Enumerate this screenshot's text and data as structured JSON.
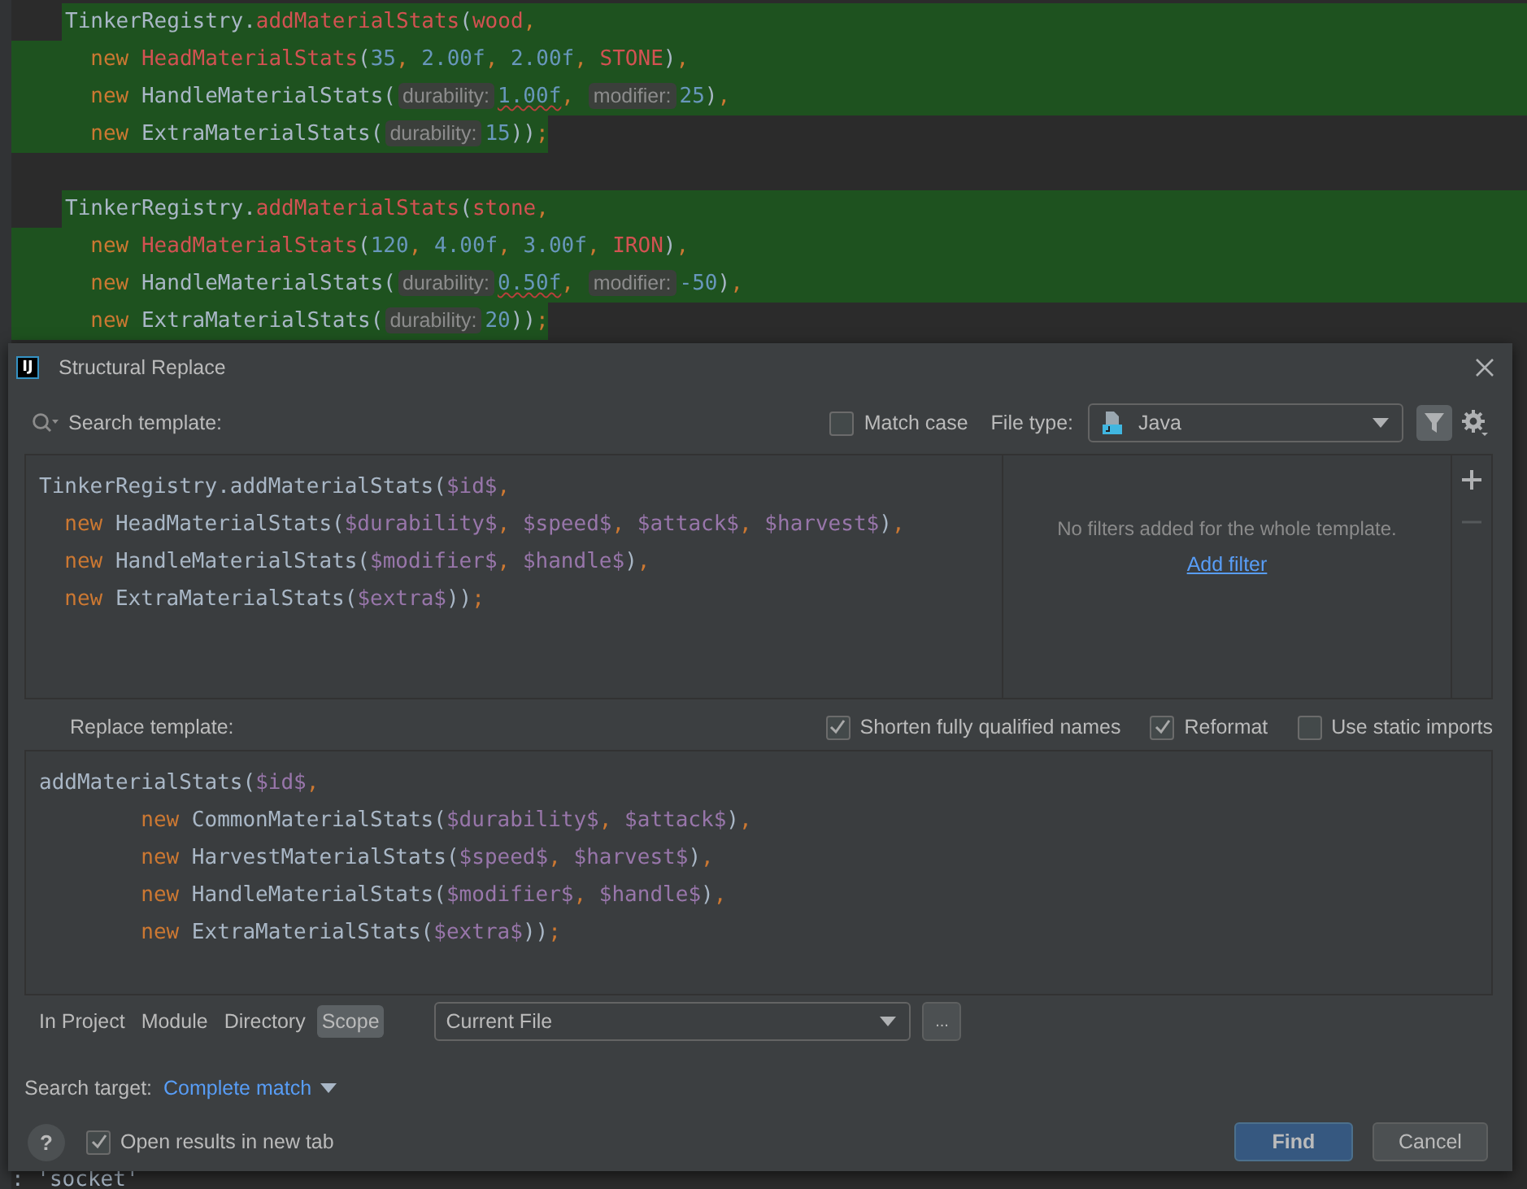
{
  "editor": {
    "lines": [
      {
        "kind": "start",
        "tokens": [
          {
            "t": "TinkerRegistry.",
            "kind": "plain"
          },
          {
            "t": "addMaterialStats",
            "kind": "error"
          },
          {
            "t": "(",
            "kind": "plain"
          },
          {
            "t": "wood",
            "kind": "error"
          },
          {
            "t": ",",
            "kind": "punct"
          }
        ]
      },
      {
        "kind": "middle",
        "tokens": [
          {
            "t": "  new ",
            "kind": "keyword"
          },
          {
            "t": "HeadMaterialStats",
            "kind": "error"
          },
          {
            "t": "(",
            "kind": "plain"
          },
          {
            "t": "35",
            "kind": "number"
          },
          {
            "t": ", ",
            "kind": "punct"
          },
          {
            "t": "2.00f",
            "kind": "number"
          },
          {
            "t": ", ",
            "kind": "punct"
          },
          {
            "t": "2.00f",
            "kind": "number"
          },
          {
            "t": ", ",
            "kind": "punct"
          },
          {
            "t": "STONE",
            "kind": "error"
          },
          {
            "t": ")",
            "kind": "plain"
          },
          {
            "t": ",",
            "kind": "punct"
          }
        ]
      },
      {
        "kind": "middle",
        "tokens": [
          {
            "t": "  new ",
            "kind": "keyword"
          },
          {
            "t": "HandleMaterialStats(",
            "kind": "plain"
          },
          {
            "t": "durability:",
            "kind": "hint"
          },
          {
            "t": "1.00f",
            "kind": "warn"
          },
          {
            "t": ", ",
            "kind": "punct"
          },
          {
            "t": "modifier:",
            "kind": "hint"
          },
          {
            "t": "25",
            "kind": "number"
          },
          {
            "t": ")",
            "kind": "plain"
          },
          {
            "t": ",",
            "kind": "punct"
          }
        ]
      },
      {
        "kind": "end",
        "tokens": [
          {
            "t": "  new ",
            "kind": "keyword"
          },
          {
            "t": "ExtraMaterialStats(",
            "kind": "plain"
          },
          {
            "t": "durability:",
            "kind": "hint"
          },
          {
            "t": "15",
            "kind": "number"
          },
          {
            "t": "))",
            "kind": "plain"
          },
          {
            "t": ";",
            "kind": "punct"
          }
        ]
      },
      {
        "kind": "blank"
      },
      {
        "kind": "start",
        "tokens": [
          {
            "t": "TinkerRegistry.",
            "kind": "plain"
          },
          {
            "t": "addMaterialStats",
            "kind": "error"
          },
          {
            "t": "(",
            "kind": "plain"
          },
          {
            "t": "stone",
            "kind": "error"
          },
          {
            "t": ",",
            "kind": "punct"
          }
        ]
      },
      {
        "kind": "middle",
        "tokens": [
          {
            "t": "  new ",
            "kind": "keyword"
          },
          {
            "t": "HeadMaterialStats",
            "kind": "error"
          },
          {
            "t": "(",
            "kind": "plain"
          },
          {
            "t": "120",
            "kind": "number"
          },
          {
            "t": ", ",
            "kind": "punct"
          },
          {
            "t": "4.00f",
            "kind": "number"
          },
          {
            "t": ", ",
            "kind": "punct"
          },
          {
            "t": "3.00f",
            "kind": "number"
          },
          {
            "t": ", ",
            "kind": "punct"
          },
          {
            "t": "IRON",
            "kind": "error"
          },
          {
            "t": ")",
            "kind": "plain"
          },
          {
            "t": ",",
            "kind": "punct"
          }
        ]
      },
      {
        "kind": "middle",
        "tokens": [
          {
            "t": "  new ",
            "kind": "keyword"
          },
          {
            "t": "HandleMaterialStats(",
            "kind": "plain"
          },
          {
            "t": "durability:",
            "kind": "hint"
          },
          {
            "t": "0.50f",
            "kind": "warn"
          },
          {
            "t": ", ",
            "kind": "punct"
          },
          {
            "t": "modifier:",
            "kind": "hint"
          },
          {
            "t": "-50",
            "kind": "number"
          },
          {
            "t": ")",
            "kind": "plain"
          },
          {
            "t": ",",
            "kind": "punct"
          }
        ]
      },
      {
        "kind": "end",
        "tokens": [
          {
            "t": "  new ",
            "kind": "keyword"
          },
          {
            "t": "ExtraMaterialStats(",
            "kind": "plain"
          },
          {
            "t": "durability:",
            "kind": "hint"
          },
          {
            "t": "20",
            "kind": "number"
          },
          {
            "t": "))",
            "kind": "plain"
          },
          {
            "t": ";",
            "kind": "punct"
          }
        ]
      }
    ],
    "bottom_line": [
      {
        "t": ": ",
        "kind": "plain"
      },
      {
        "t": "'socket'",
        "kind": "plain"
      }
    ]
  },
  "dialog": {
    "app_icon": "IJ",
    "title": "Structural Replace",
    "search_label": "Search template:",
    "match_case": {
      "label": "Match case",
      "checked": false
    },
    "file_type": {
      "label": "File type:",
      "value": "Java"
    },
    "filter_button": {
      "selected": true
    },
    "search_template": [
      [
        {
          "t": "TinkerRegistry.addMaterialStats(",
          "kind": "plain"
        },
        {
          "t": "$id$",
          "kind": "var"
        },
        {
          "t": ",",
          "kind": "punct"
        }
      ],
      [
        {
          "t": "  new ",
          "kind": "keyword"
        },
        {
          "t": "HeadMaterialStats(",
          "kind": "plain"
        },
        {
          "t": "$durability$",
          "kind": "var"
        },
        {
          "t": ", ",
          "kind": "punct"
        },
        {
          "t": "$speed$",
          "kind": "var"
        },
        {
          "t": ", ",
          "kind": "punct"
        },
        {
          "t": "$attack$",
          "kind": "var"
        },
        {
          "t": ", ",
          "kind": "punct"
        },
        {
          "t": "$harvest$",
          "kind": "var"
        },
        {
          "t": ")",
          "kind": "plain"
        },
        {
          "t": ",",
          "kind": "punct"
        }
      ],
      [
        {
          "t": "  new ",
          "kind": "keyword"
        },
        {
          "t": "HandleMaterialStats(",
          "kind": "plain"
        },
        {
          "t": "$modifier$",
          "kind": "var"
        },
        {
          "t": ", ",
          "kind": "punct"
        },
        {
          "t": "$handle$",
          "kind": "var"
        },
        {
          "t": ")",
          "kind": "plain"
        },
        {
          "t": ",",
          "kind": "punct"
        }
      ],
      [
        {
          "t": "  new ",
          "kind": "keyword"
        },
        {
          "t": "ExtraMaterialStats(",
          "kind": "plain"
        },
        {
          "t": "$extra$",
          "kind": "var"
        },
        {
          "t": "))",
          "kind": "plain"
        },
        {
          "t": ";",
          "kind": "punct"
        }
      ]
    ],
    "filters": {
      "empty_text": "No filters added for the whole template.",
      "link": "Add filter"
    },
    "replace_label": "Replace template:",
    "options": [
      {
        "label": "Shorten fully qualified names",
        "checked": true
      },
      {
        "label": "Reformat",
        "checked": true
      },
      {
        "label": "Use static imports",
        "checked": false
      }
    ],
    "replace_template": [
      [
        {
          "t": "addMaterialStats(",
          "kind": "plain"
        },
        {
          "t": "$id$",
          "kind": "var"
        },
        {
          "t": ",",
          "kind": "punct"
        }
      ],
      [
        {
          "t": "        new ",
          "kind": "keyword"
        },
        {
          "t": "CommonMaterialStats(",
          "kind": "plain"
        },
        {
          "t": "$durability$",
          "kind": "var"
        },
        {
          "t": ", ",
          "kind": "punct"
        },
        {
          "t": "$attack$",
          "kind": "var"
        },
        {
          "t": ")",
          "kind": "plain"
        },
        {
          "t": ",",
          "kind": "punct"
        }
      ],
      [
        {
          "t": "        new ",
          "kind": "keyword"
        },
        {
          "t": "HarvestMaterialStats(",
          "kind": "plain"
        },
        {
          "t": "$speed$",
          "kind": "var"
        },
        {
          "t": ", ",
          "kind": "punct"
        },
        {
          "t": "$harvest$",
          "kind": "var"
        },
        {
          "t": ")",
          "kind": "plain"
        },
        {
          "t": ",",
          "kind": "punct"
        }
      ],
      [
        {
          "t": "        new ",
          "kind": "keyword"
        },
        {
          "t": "HandleMaterialStats(",
          "kind": "plain"
        },
        {
          "t": "$modifier$",
          "kind": "var"
        },
        {
          "t": ", ",
          "kind": "punct"
        },
        {
          "t": "$handle$",
          "kind": "var"
        },
        {
          "t": ")",
          "kind": "plain"
        },
        {
          "t": ",",
          "kind": "punct"
        }
      ],
      [
        {
          "t": "        new ",
          "kind": "keyword"
        },
        {
          "t": "ExtraMaterialStats(",
          "kind": "plain"
        },
        {
          "t": "$extra$",
          "kind": "var"
        },
        {
          "t": "))",
          "kind": "plain"
        },
        {
          "t": ";",
          "kind": "punct"
        }
      ]
    ],
    "scope_tabs": [
      {
        "label": "In Project",
        "selected": false
      },
      {
        "label": "Module",
        "selected": false
      },
      {
        "label": "Directory",
        "selected": false
      },
      {
        "label": "Scope",
        "selected": true
      }
    ],
    "scope_value": "Current File",
    "browse_button": "...",
    "search_target": {
      "label": "Search target:",
      "value": "Complete match"
    },
    "help": "?",
    "open_in_new_tab": {
      "label": "Open results in new tab",
      "checked": true
    },
    "buttons": [
      {
        "label": "Find",
        "kind": "primary"
      },
      {
        "label": "Cancel",
        "kind": "secondary"
      }
    ]
  }
}
